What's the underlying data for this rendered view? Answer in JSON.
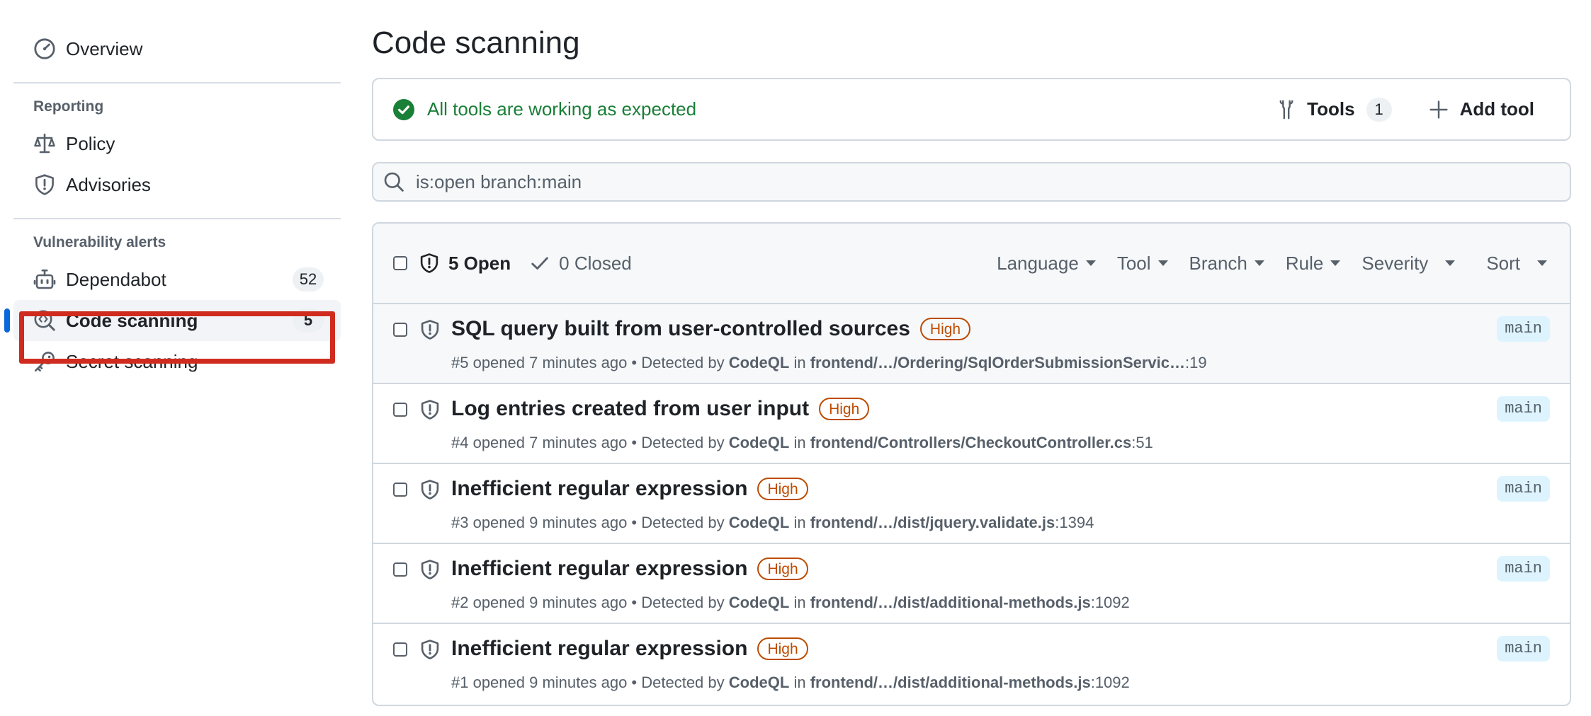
{
  "sidebar": {
    "overview_label": "Overview",
    "reporting_heading": "Reporting",
    "policy_label": "Policy",
    "advisories_label": "Advisories",
    "vuln_heading": "Vulnerability alerts",
    "dependabot_label": "Dependabot",
    "dependabot_count": "52",
    "code_scanning_label": "Code scanning",
    "code_scanning_count": "5",
    "secret_scanning_label": "Secret scanning"
  },
  "page": {
    "title": "Code scanning"
  },
  "status": {
    "message": "All tools are working as expected",
    "tools_label": "Tools",
    "tools_count": "1",
    "add_tool_label": "Add tool"
  },
  "search": {
    "value": "is:open branch:main"
  },
  "table": {
    "open_label": "5 Open",
    "closed_label": "0 Closed",
    "filters": {
      "language": "Language",
      "tool": "Tool",
      "branch": "Branch",
      "rule": "Rule",
      "severity": "Severity",
      "sort": "Sort"
    },
    "alerts": [
      {
        "title": "SQL query built from user-controlled sources",
        "severity": "High",
        "meta_prefix": "#5 opened 7 minutes ago • Detected by",
        "tool": "CodeQL",
        "in": "in",
        "path": "frontend/…/Ordering/SqlOrderSubmissionServic…",
        "line": ":19",
        "branch": "main"
      },
      {
        "title": "Log entries created from user input",
        "severity": "High",
        "meta_prefix": "#4 opened 7 minutes ago • Detected by",
        "tool": "CodeQL",
        "in": "in",
        "path": "frontend/Controllers/CheckoutController.cs",
        "line": ":51",
        "branch": "main"
      },
      {
        "title": "Inefficient regular expression",
        "severity": "High",
        "meta_prefix": "#3 opened 9 minutes ago • Detected by",
        "tool": "CodeQL",
        "in": "in",
        "path": "frontend/…/dist/jquery.validate.js",
        "line": ":1394",
        "branch": "main"
      },
      {
        "title": "Inefficient regular expression",
        "severity": "High",
        "meta_prefix": "#2 opened 9 minutes ago • Detected by",
        "tool": "CodeQL",
        "in": "in",
        "path": "frontend/…/dist/additional-methods.js",
        "line": ":1092",
        "branch": "main"
      },
      {
        "title": "Inefficient regular expression",
        "severity": "High",
        "meta_prefix": "#1 opened 9 minutes ago • Detected by",
        "tool": "CodeQL",
        "in": "in",
        "path": "frontend/…/dist/additional-methods.js",
        "line": ":1092",
        "branch": "main"
      }
    ]
  },
  "colors": {
    "accent": "#0969da",
    "success": "#1a7f37",
    "severity_high": "#bc4c00",
    "highlight_annotation": "#cf2b1e"
  },
  "icons": [
    "meter-icon",
    "law-icon",
    "shield-icon",
    "dependabot-icon",
    "codescan-icon",
    "key-icon",
    "check-circle-icon",
    "tools-icon",
    "plus-icon",
    "search-icon",
    "check-icon",
    "chevron-down-icon"
  ]
}
